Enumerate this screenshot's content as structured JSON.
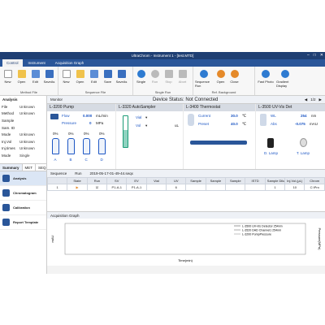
{
  "window": {
    "title": "UltraChrom - Instrument 1 - [test.MTD]",
    "minimize": "–",
    "maximize": "□",
    "close": "✕"
  },
  "menu": [
    "Control",
    "Instrument",
    "Acquisition Graph"
  ],
  "ribbon": {
    "groups": [
      {
        "label": "Method File",
        "buttons": [
          "New",
          "Open",
          "Edit",
          "SaveAs"
        ]
      },
      {
        "label": "Sequence File",
        "buttons": [
          "New",
          "Open",
          "Edit",
          "Save",
          "SaveAs"
        ]
      },
      {
        "label": "Single Run",
        "buttons": [
          "Single",
          "Run",
          "Stop",
          "Abort"
        ]
      },
      {
        "label": "Ref. Background",
        "buttons": [
          "Sequence Run",
          "Open",
          "Close"
        ]
      },
      {
        "label": "",
        "buttons": [
          "Fast Photo",
          "Gradient Display"
        ]
      }
    ]
  },
  "analysis": {
    "header": "Analysis",
    "rows": [
      {
        "k": "File",
        "v": "Unknown"
      },
      {
        "k": "Method",
        "v": "Unknown"
      },
      {
        "k": "Sample",
        "v": ""
      },
      {
        "k": "Sam. ID",
        "v": ""
      },
      {
        "k": "Mode",
        "v": "Unknown"
      },
      {
        "k": "Inj.Vol",
        "v": "Unknown"
      },
      {
        "k": "Inj.times",
        "v": "Unknown"
      },
      {
        "k": "Mode",
        "v": "Single"
      }
    ],
    "tabs": [
      "Summary",
      "MET",
      "SEQ"
    ],
    "nav": [
      "Analysis",
      "Chromatogram",
      "Calibration",
      "Report Template"
    ]
  },
  "monitor": {
    "title": "Monitor",
    "status": "Device Status:  Not Connected",
    "page": "1/2"
  },
  "pump": {
    "title": "L-3200 Pump",
    "flow_label": "Flow",
    "flow_val": "0.000",
    "flow_unit": "mL/min",
    "pressure_label": "Pressure",
    "pressure_val": "0",
    "pressure_unit": "MPa",
    "channels": [
      {
        "pct": "0%",
        "name": "A"
      },
      {
        "pct": "0%",
        "name": "B"
      },
      {
        "pct": "0%",
        "name": "C"
      },
      {
        "pct": "0%",
        "name": "D"
      }
    ]
  },
  "autosampler": {
    "title": "L-3320 AutoSampler",
    "vial_label": "Vial",
    "vol_label": "Vol",
    "vol_unit": "uL"
  },
  "thermostat": {
    "title": "L-3400 Thermostat",
    "current_label": "Current",
    "current_val": "30.0",
    "preset_label": "Preset",
    "preset_val": "40.0",
    "unit": "℃"
  },
  "uvvis": {
    "title": "L-3500 UV-Vis Det",
    "wl_label": "WL",
    "wl_val": "254",
    "wl_unit": "nm",
    "abs_label": "Abs",
    "abs_val": "-0.075",
    "abs_unit": "mAU",
    "d_lamp": "D. Lamp",
    "t_lamp": "T. Lamp"
  },
  "sequence": {
    "label": "Sequence",
    "run": "Run",
    "name": "2019-05-17-01-49-44.seqx",
    "columns": [
      "",
      "State",
      "Run",
      "SV",
      "EV",
      "Vial",
      "UV",
      "Sample",
      "Sample",
      "Sample",
      "ISTD",
      "Sample Dilut.",
      "Inj.Vol.(μL)",
      "Chrom"
    ],
    "rows": [
      [
        "1",
        "",
        "☑",
        "P1-A-1",
        "P1-A-1",
        "",
        "6",
        "",
        "",
        "",
        "",
        "1",
        "10",
        "C:\\Pro"
      ]
    ]
  },
  "graph": {
    "title": "Acquisition Graph",
    "ylabel_left": "mAU",
    "ylabel_right": "Pressure(MPa)",
    "xlabel": "Time(min)",
    "legend": [
      "L-3500 UV-Vis Detector 254nm",
      "L-3520 DAD Channel1 254nm",
      "L-3200 PumpPressure"
    ]
  }
}
